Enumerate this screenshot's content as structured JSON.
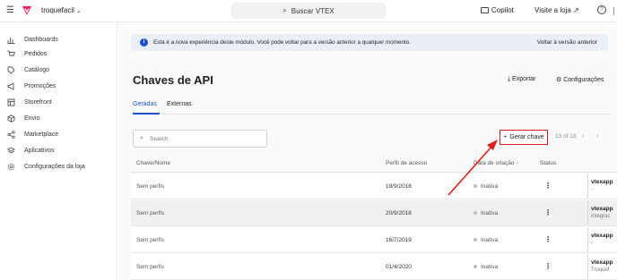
{
  "topbar": {
    "store_name": "troquefacil",
    "search_label": "Buscar VTEX",
    "copilot_label": "Copilot",
    "visit_store_label": "Visite a loja ↗",
    "help_glyph": "?"
  },
  "sidebar": {
    "items": [
      {
        "label": "Dashboards",
        "icon": "chart-icon"
      },
      {
        "label": "Pedidos",
        "icon": "cart-icon"
      },
      {
        "label": "Catálogo",
        "icon": "tag-icon"
      },
      {
        "label": "Promoções",
        "icon": "megaphone-icon"
      },
      {
        "label": "Storefront",
        "icon": "layout-icon"
      },
      {
        "label": "Envio",
        "icon": "box-icon"
      },
      {
        "label": "Marketplace",
        "icon": "share-icon"
      },
      {
        "label": "Aplicativos",
        "icon": "layers-icon"
      },
      {
        "label": "Configurações da loja",
        "icon": "gear-icon"
      }
    ]
  },
  "banner": {
    "message": "Esta é a nova experiência deste módulo. Você pode voltar para a versão anterior a qualquer momento.",
    "back_link": "Voltar à versão anterior"
  },
  "page": {
    "title": "Chaves de API",
    "export_label": "Exportar",
    "settings_label": "Configurações"
  },
  "tabs": [
    {
      "label": "Geradas",
      "active": true
    },
    {
      "label": "Externas",
      "active": false
    }
  ],
  "search": {
    "placeholder": "Search"
  },
  "toolbar": {
    "generate_label": "Gerar chave",
    "pager_text": "13 of 13"
  },
  "table": {
    "headers": {
      "name": "Chave/Nome",
      "profile": "Perfil de acesso",
      "created": "Data de criação",
      "status": "Status"
    },
    "rows": [
      {
        "name": "Sem perfis",
        "date": "19/9/2018",
        "status": "Inativa",
        "key": "vtexapp",
        "sub": "-"
      },
      {
        "name": "Sem perfis",
        "date": "20/9/2018",
        "status": "Inativa",
        "key": "vtexapp",
        "sub": "integrac"
      },
      {
        "name": "Sem perfis",
        "date": "16/7/2019",
        "status": "Inativa",
        "key": "vtexapp",
        "sub": "-"
      },
      {
        "name": "Sem perfis",
        "date": "01/4/2020",
        "status": "Inativa",
        "key": "vtexapp",
        "sub": "Troquef"
      }
    ]
  },
  "colors": {
    "brand": "#f71963",
    "accent": "#1e4fd0",
    "highlight": "#e11d1d"
  }
}
